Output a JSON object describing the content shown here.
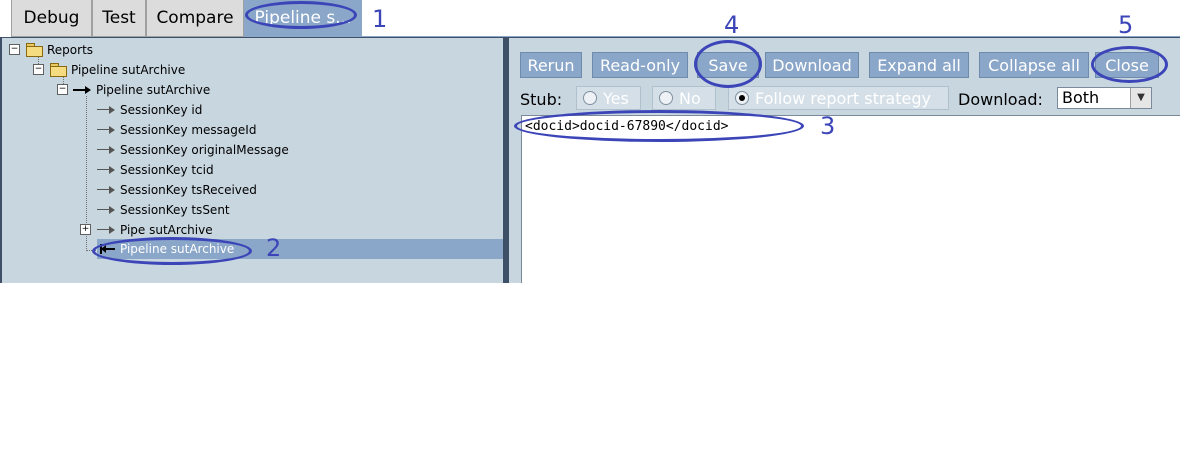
{
  "tabs": [
    {
      "label": "Debug"
    },
    {
      "label": "Test"
    },
    {
      "label": "Compare"
    },
    {
      "label": "Pipeline s..."
    }
  ],
  "tree": {
    "root": {
      "label": "Reports",
      "toggle": "−"
    },
    "pipeline": {
      "label": "Pipeline sutArchive",
      "toggle": "−"
    },
    "pipeline_inner": {
      "label": "Pipeline sutArchive",
      "toggle": "−"
    },
    "items": [
      {
        "label": "SessionKey id"
      },
      {
        "label": "SessionKey messageId"
      },
      {
        "label": "SessionKey originalMessage"
      },
      {
        "label": "SessionKey tcid"
      },
      {
        "label": "SessionKey tsReceived"
      },
      {
        "label": "SessionKey tsSent"
      }
    ],
    "pipe": {
      "label": "Pipe sutArchive",
      "toggle": "+"
    },
    "selected": {
      "label": "Pipeline sutArchive"
    }
  },
  "toolbar": {
    "rerun": "Rerun",
    "readonly": "Read-only",
    "save": "Save",
    "download": "Download",
    "expand_all": "Expand all",
    "collapse_all": "Collapse all",
    "close": "Close"
  },
  "stub": {
    "label": "Stub:",
    "options": [
      {
        "label": "Yes",
        "selected": false
      },
      {
        "label": "No",
        "selected": false
      },
      {
        "label": "Follow report strategy",
        "selected": true
      }
    ]
  },
  "download_select": {
    "label": "Download:",
    "value": "Both"
  },
  "editor": {
    "content": "<docid>docid-67890</docid>"
  },
  "annotations": [
    "1",
    "2",
    "3",
    "4",
    "5"
  ],
  "colors": {
    "accent": "#8aa6c8",
    "pane": "#c8d6e0",
    "annotation": "#3b45b8",
    "dark": "#3d5068"
  }
}
